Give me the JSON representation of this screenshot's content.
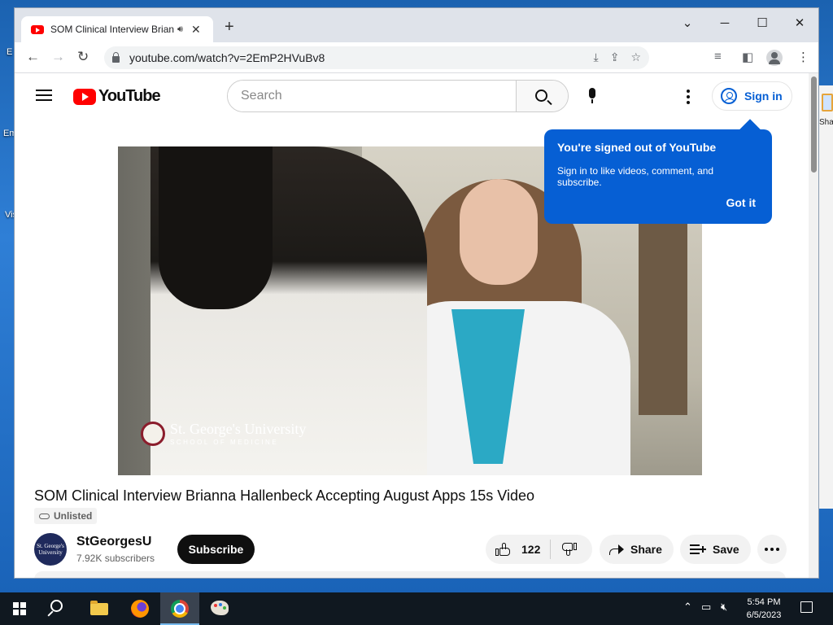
{
  "browser": {
    "tab_title": "SOM Clinical Interview Brianna Hallenbeck Accepting August Apps 15s Video",
    "new_tab": "+",
    "url": "youtube.com/watch?v=2EmP2HVuBv8",
    "controls": {
      "dropdown": "⌄",
      "minimize": "─",
      "maximize": "☐",
      "close": "✕"
    },
    "nav": {
      "back": "←",
      "forward": "→",
      "reload": "↻"
    }
  },
  "youtube": {
    "logo_text": "YouTube",
    "search_placeholder": "Search",
    "signin_label": "Sign in",
    "popup": {
      "heading": "You're signed out of YouTube",
      "body": "Sign in to like videos, comment, and subscribe.",
      "action": "Got it"
    },
    "video": {
      "watermark_line1": "St. George's University",
      "watermark_line2": "SCHOOL OF MEDICINE"
    },
    "title": "SOM Clinical Interview Brianna Hallenbeck Accepting August Apps 15s Video",
    "badge": "Unlisted",
    "channel": {
      "name": "StGeorgesU",
      "subscribers": "7.92K subscribers"
    },
    "subscribe_label": "Subscribe",
    "likes": "122",
    "share_label": "Share",
    "save_label": "Save"
  },
  "taskbar": {
    "time": "5:54 PM",
    "date": "6/5/2023"
  },
  "colors": {
    "youtube_red": "#ff0000",
    "link_blue": "#065fd4",
    "popup_bg": "#065fd4"
  }
}
